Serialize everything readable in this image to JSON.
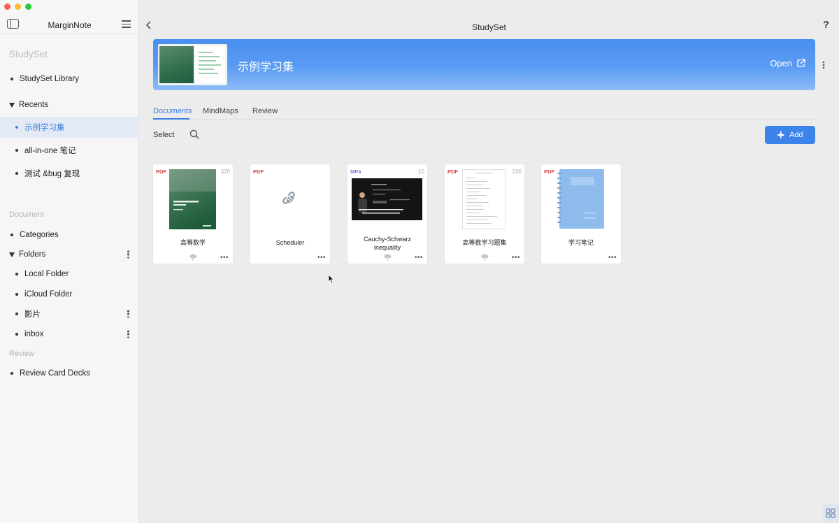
{
  "window": {
    "traffic": [
      "close",
      "minimize",
      "zoom"
    ]
  },
  "sidebar": {
    "app_title": "MarginNote",
    "studyset_label": "StudySet",
    "library_item": "StudySet Library",
    "recents_label": "Recents",
    "recents": [
      "示例学习集",
      "all-in-one 笔记",
      "测试 &bug 复现"
    ],
    "selected_recent": "示例学习集",
    "document_label": "Document",
    "categories_item": "Categories",
    "folders_label": "Folders",
    "folders": [
      "Local Folder",
      "iCloud Folder",
      "影片",
      "inbox"
    ],
    "review_label": "Review",
    "review_item": "Review Card Decks"
  },
  "topbar": {
    "title": "StudySet",
    "help": "?"
  },
  "banner": {
    "title": "示例学习集",
    "open_label": "Open"
  },
  "tabs": [
    "Documents",
    "MindMaps",
    "Review"
  ],
  "active_tab": "Documents",
  "toolbar": {
    "select_label": "Select",
    "add_label": "Add"
  },
  "documents": [
    {
      "type": "PDF",
      "count": "320",
      "name": "高等数学",
      "thumb": "green-book-cover"
    },
    {
      "type": "PDF",
      "count": "",
      "name": "Scheduler",
      "thumb": "link-icon"
    },
    {
      "type": "MP4",
      "count": "10",
      "name": "Cauchy-Schwarz inequality",
      "thumb": "video-lecture"
    },
    {
      "type": "PDF",
      "count": "226",
      "name": "高等数学习题集",
      "thumb": "text-page"
    },
    {
      "type": "PDF",
      "count": "",
      "name": "学习笔记",
      "thumb": "blue-notebook"
    }
  ],
  "colors": {
    "accent": "#3d7de2",
    "pdf": "#d63f3f",
    "mp4": "#8a74d8"
  }
}
